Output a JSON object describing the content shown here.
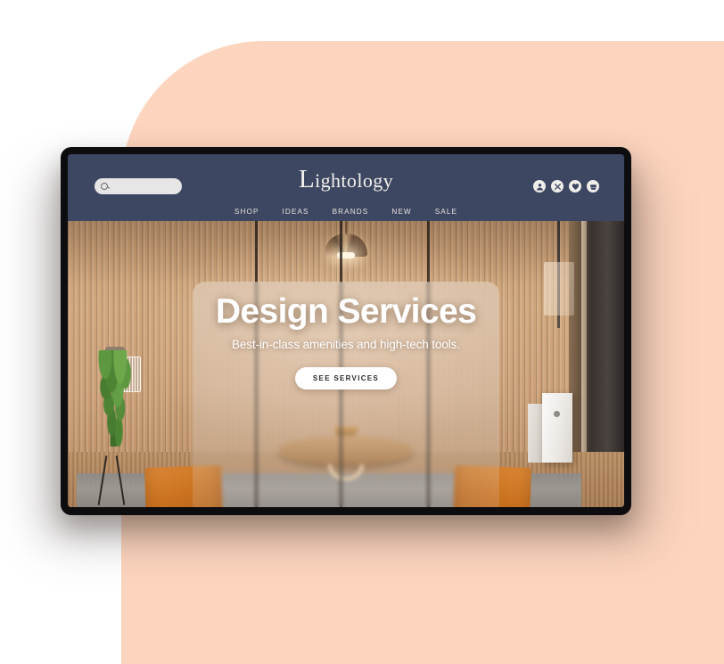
{
  "canvas": {
    "background_color": "#FFFFFF",
    "accent_shape_color": "#FDD5BE"
  },
  "device": {
    "bezel_color": "#0D0D0F"
  },
  "site": {
    "header": {
      "background_color": "#3E4761",
      "brand": {
        "initial": "L",
        "rest": "ightology",
        "full": "Lightology"
      },
      "search": {
        "icon": "search-icon",
        "value": "",
        "placeholder": ""
      },
      "icons": [
        {
          "name": "account-icon",
          "label": "Account"
        },
        {
          "name": "tools-icon",
          "label": "Tools"
        },
        {
          "name": "wishlist-heart-icon",
          "label": "Wishlist"
        },
        {
          "name": "shopping-cart-icon",
          "label": "Cart"
        }
      ],
      "nav": [
        {
          "label": "SHOP"
        },
        {
          "label": "IDEAS"
        },
        {
          "label": "BRANDS"
        },
        {
          "label": "NEW"
        },
        {
          "label": "SALE"
        }
      ]
    },
    "hero": {
      "title": "Design Services",
      "subtitle": "Best-in-class amenities and high-tech tools.",
      "cta_label": "SEE SERVICES",
      "scene_description": "Interior room with wood slat wall, hanging plant, two orange leather lounge chairs, live-edge wood slab table, pendant lamp and marble pedestal"
    }
  }
}
